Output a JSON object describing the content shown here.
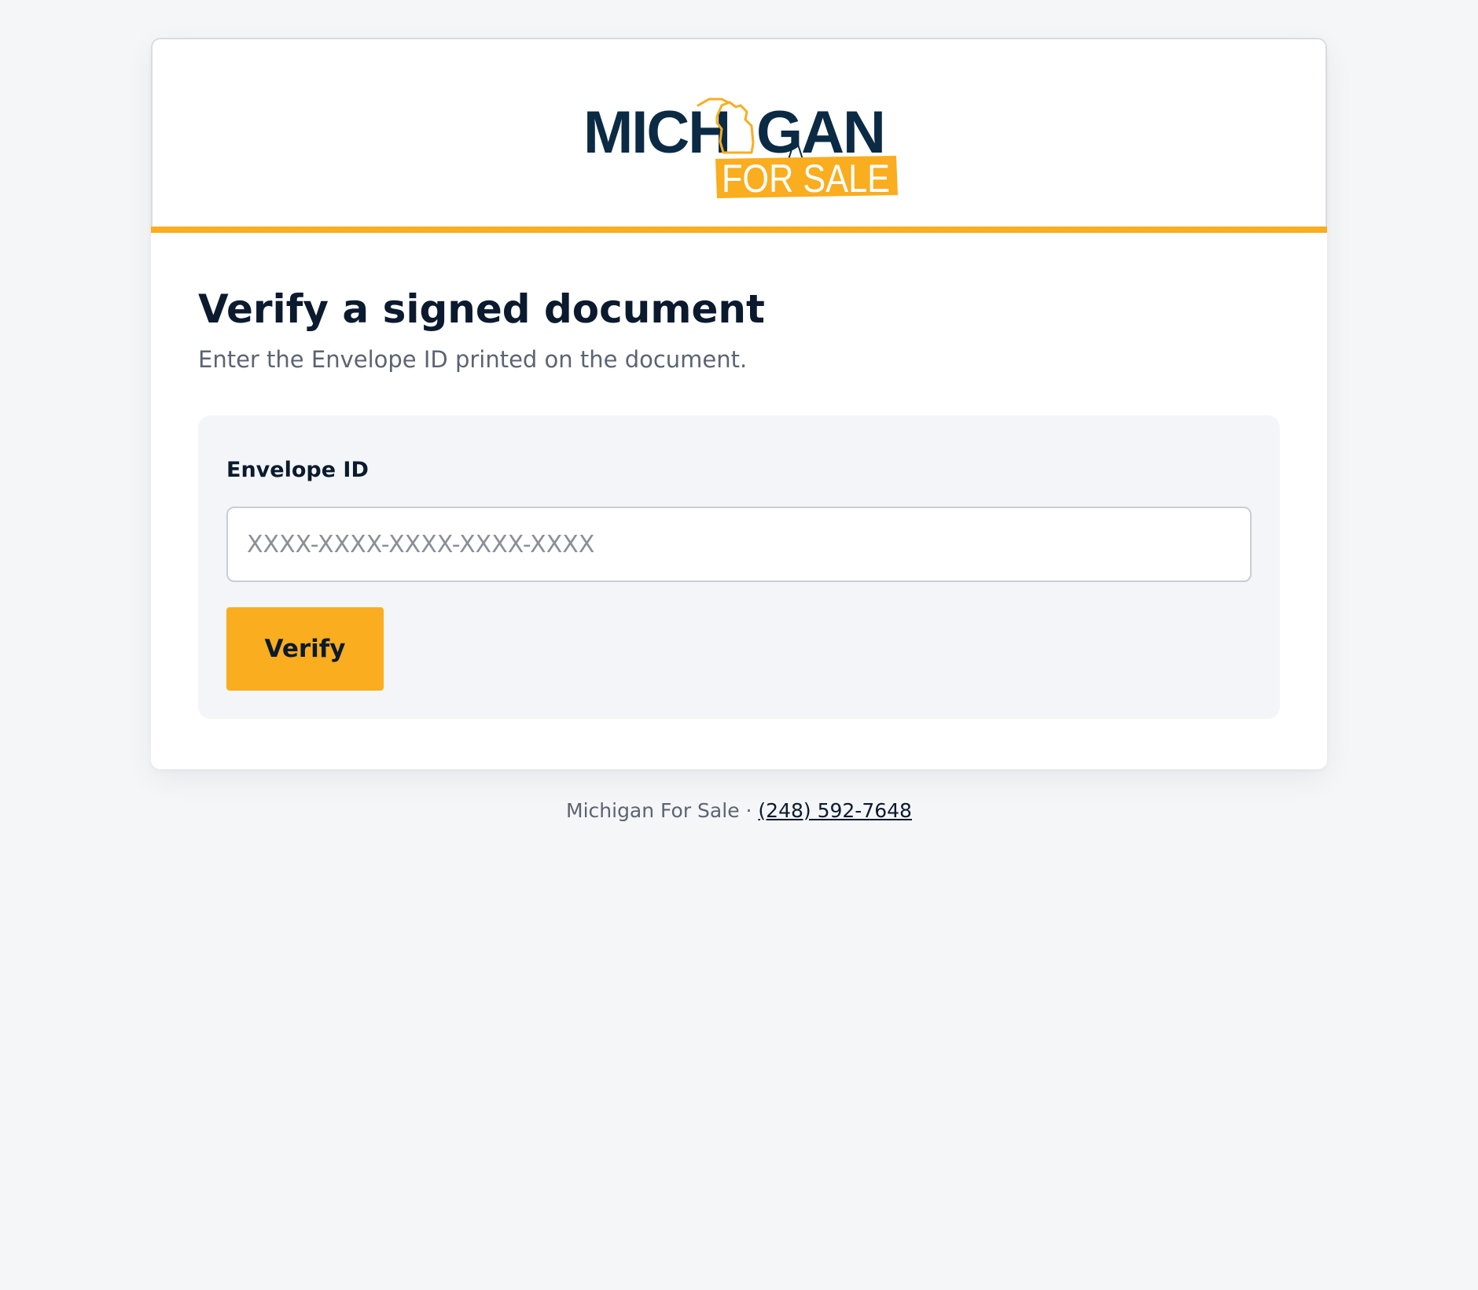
{
  "header": {
    "logo": {
      "wordmark": "MICHIGAN",
      "tagline": "FOR SALE",
      "navy": "#0b2a44",
      "gold": "#f9ad1f"
    },
    "accent_color": "#f9ad1f"
  },
  "main": {
    "title": "Verify a signed document",
    "subtitle": "Enter the Envelope ID printed on the document.",
    "form": {
      "label": "Envelope ID",
      "input_value": "",
      "input_placeholder": "XXXX-XXXX-XXXX-XXXX-XXXX",
      "submit_label": "Verify"
    }
  },
  "footer": {
    "company": "Michigan For Sale",
    "separator": " · ",
    "phone": "(248) 592-7648"
  }
}
